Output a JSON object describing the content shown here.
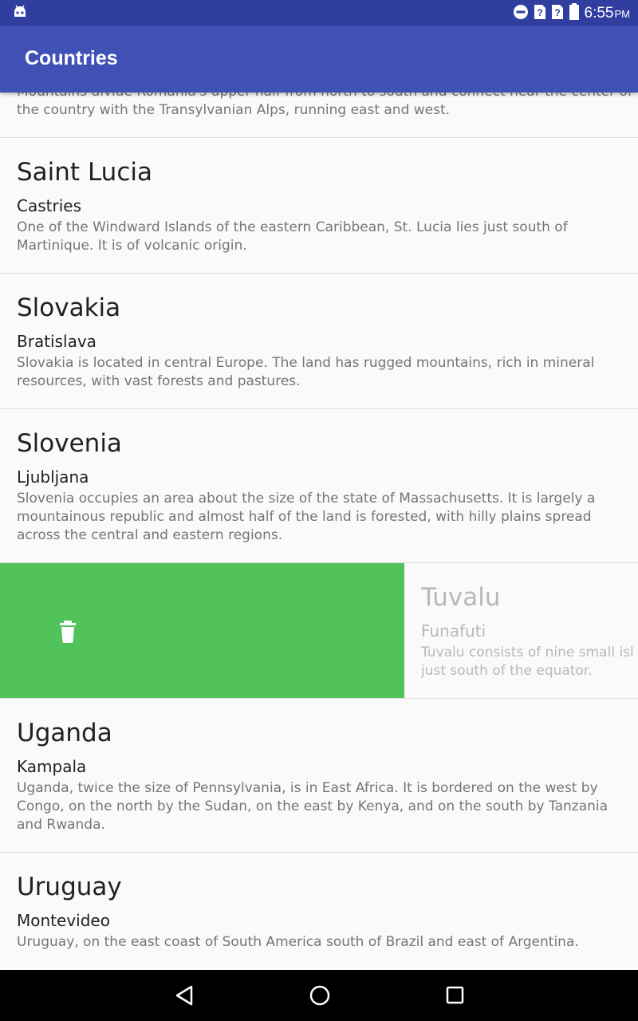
{
  "status_bar": {
    "time": "6:55",
    "ampm": "PM",
    "icons": [
      "android-debug-icon",
      "do-not-disturb-icon",
      "no-sim-icon",
      "no-sim-icon",
      "battery-icon"
    ]
  },
  "app_bar": {
    "title": "Countries"
  },
  "list": {
    "partial_top": {
      "desc_line1": "Mountains divide Romania's upper half from north to south and connect near the center of",
      "desc_line2": "the country with the Transylvanian Alps, running east and west."
    },
    "items": [
      {
        "name": "Saint Lucia",
        "capital": "Castries",
        "description": "One of the Windward Islands of the eastern Caribbean, St. Lucia lies just south of Martinique. It is of volcanic origin."
      },
      {
        "name": "Slovakia",
        "capital": "Bratislava",
        "description": "Slovakia is located in central Europe. The land has rugged mountains, rich in mineral resources, with vast forests and pastures."
      },
      {
        "name": "Slovenia",
        "capital": "Ljubljana",
        "description": "Slovenia occupies an area about the size of the state of Massachusetts. It is largely a mountainous republic and almost half of the land is forested, with hilly plains spread across the central and eastern regions."
      },
      {
        "name": "Tuvalu",
        "capital": "Funafuti",
        "description_line1": "Tuvalu consists of nine small isl",
        "description_line2": "just south of the equator.",
        "swipe_action_icon": "trash-icon",
        "swipe_color": "#52c35a"
      },
      {
        "name": "Uganda",
        "capital": "Kampala",
        "description": "Uganda, twice the size of Pennsylvania, is in East Africa. It is bordered on the west by Congo, on the north by the Sudan, on the east by Kenya, and on the south by Tanzania and Rwanda."
      },
      {
        "name": "Uruguay",
        "capital": "Montevideo",
        "description": "Uruguay, on the east coast of South America south of Brazil and east of Argentina."
      }
    ]
  },
  "nav_bar": {
    "icons": [
      "back-icon",
      "home-icon",
      "recents-icon"
    ]
  },
  "colors": {
    "status_bar": "#303f9f",
    "app_bar": "#3f51b5",
    "swipe_background": "#52c35a"
  }
}
